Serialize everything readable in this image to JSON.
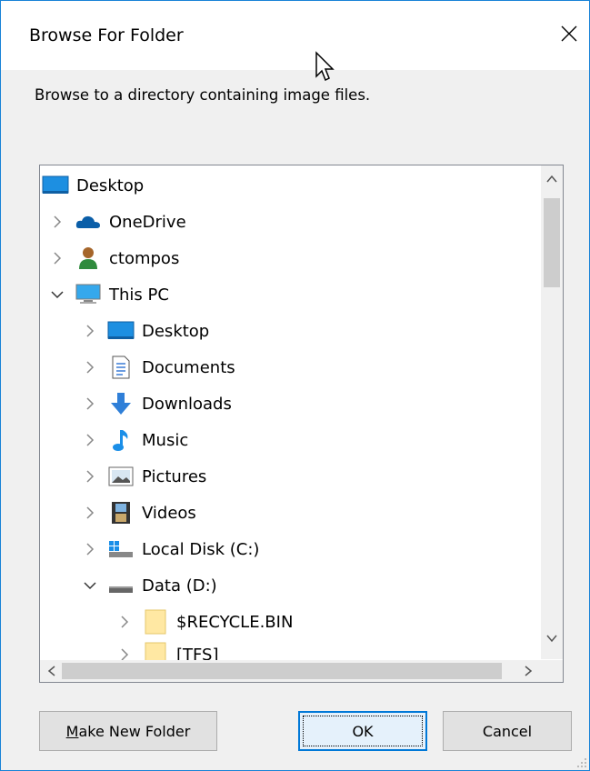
{
  "window": {
    "title": "Browse For Folder"
  },
  "instruction": "Browse to a directory containing image files.",
  "tree": {
    "items": [
      {
        "label": "Desktop",
        "icon": "desktop-icon",
        "chevron": "none"
      },
      {
        "label": "OneDrive",
        "icon": "onedrive-cloud-icon",
        "chevron": "right"
      },
      {
        "label": "ctompos",
        "icon": "user-icon",
        "chevron": "right"
      },
      {
        "label": "This PC",
        "icon": "computer-icon",
        "chevron": "down"
      },
      {
        "label": "Desktop",
        "icon": "desktop-icon",
        "chevron": "right"
      },
      {
        "label": "Documents",
        "icon": "documents-icon",
        "chevron": "right"
      },
      {
        "label": "Downloads",
        "icon": "download-arrow-icon",
        "chevron": "right"
      },
      {
        "label": "Music",
        "icon": "music-note-icon",
        "chevron": "right"
      },
      {
        "label": "Pictures",
        "icon": "pictures-icon",
        "chevron": "right"
      },
      {
        "label": "Videos",
        "icon": "film-icon",
        "chevron": "right"
      },
      {
        "label": "Local Disk (C:)",
        "icon": "local-disk-icon",
        "chevron": "right"
      },
      {
        "label": "Data (D:)",
        "icon": "drive-icon",
        "chevron": "down"
      },
      {
        "label": "$RECYCLE.BIN",
        "icon": "folder-icon",
        "chevron": "right"
      },
      {
        "label": "[TFS]",
        "icon": "folder-icon",
        "chevron": "right"
      }
    ]
  },
  "buttons": {
    "make_new_folder_prefix": "M",
    "make_new_folder_rest": "ake New Folder",
    "ok": "OK",
    "cancel": "Cancel"
  },
  "colors": {
    "accent": "#0078d7",
    "folder": "#ffe8a3",
    "desktop_blue": "#1d8fe1"
  }
}
